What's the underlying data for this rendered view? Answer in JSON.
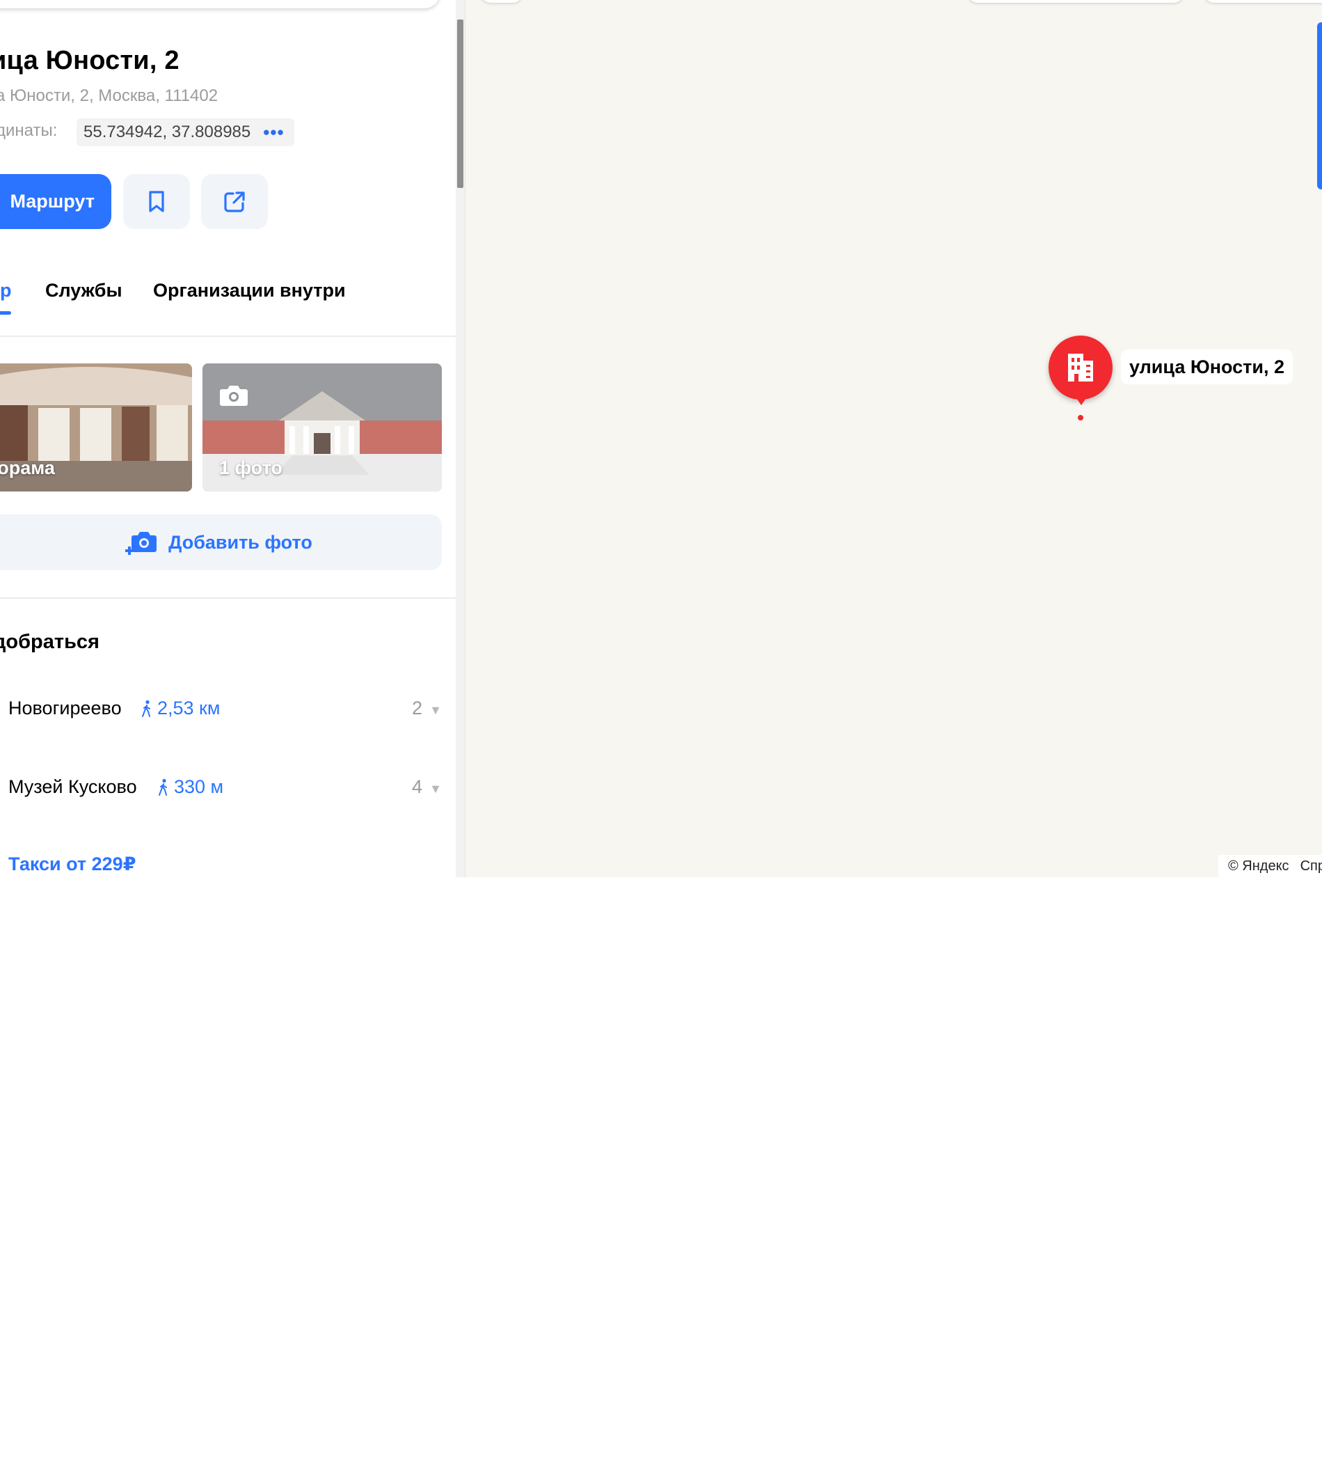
{
  "place": {
    "title": "ица Юности, 2",
    "address": "а Юности, 2, Москва, 111402",
    "coords_label": "динаты:",
    "coords_value": "55.734942, 37.808985",
    "coords_more": "•••"
  },
  "actions": {
    "route_label": "Маршрут",
    "bookmark_icon": "bookmark-icon",
    "share_icon": "share-icon"
  },
  "tabs": [
    {
      "label": "р",
      "active": true
    },
    {
      "label": "Службы",
      "active": false
    },
    {
      "label": "Организации внутри",
      "active": false
    }
  ],
  "photos": {
    "panorama_label": "норама",
    "photo_count_label": "1 фото",
    "add_photo_label": "Добавить фото"
  },
  "directions": {
    "title": "добраться",
    "stations": [
      {
        "name": "Новогиреево",
        "distance": "2,53 км",
        "count": "2"
      },
      {
        "name": "Музей Кусково",
        "distance": "330 м",
        "count": "4"
      }
    ],
    "taxi_label": "Такси от 229₽"
  },
  "map": {
    "marker_label": "улица Юности, 2",
    "marker_icon": "building-icon",
    "copyright": "© Яндекс",
    "help_link": "Спр"
  },
  "colors": {
    "accent": "#2b74ff",
    "marker": "#f2292f",
    "map_background": "#f8f6f1"
  }
}
